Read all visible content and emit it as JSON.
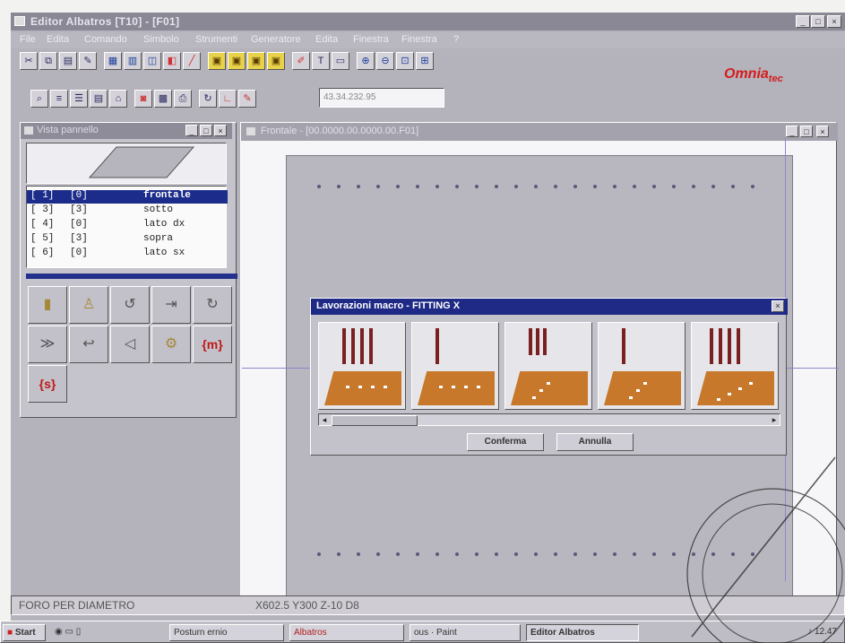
{
  "window": {
    "title": "Editor Albatros [T10] - [F01]",
    "controls": [
      "_",
      "□",
      "×"
    ]
  },
  "menubar": [
    "File",
    "Edita",
    "Comando",
    "Simbolo",
    "Strumenti",
    "Generatore",
    "Edita",
    "Finestra",
    "Finestra",
    "?"
  ],
  "brand": {
    "main": "Omnia",
    "sub": "tec"
  },
  "toolbar2": {
    "coord_value": "43.34.232.95"
  },
  "left_panel": {
    "title": "Vista pannello",
    "faces": [
      {
        "idx": "[ 1]",
        "code": "[0]",
        "name": "frontale"
      },
      {
        "idx": "[ 3]",
        "code": "[3]",
        "name": "sotto"
      },
      {
        "idx": "[ 4]",
        "code": "[0]",
        "name": "lato dx"
      },
      {
        "idx": "[ 5]",
        "code": "[3]",
        "name": "sopra"
      },
      {
        "idx": "[ 6]",
        "code": "[0]",
        "name": "lato sx"
      }
    ],
    "tools": [
      "▮",
      "♙",
      "↺",
      "⇥",
      "↻",
      "≫",
      "↩",
      "◁",
      "⚙",
      "{m}",
      "{s}"
    ]
  },
  "drawing_window": {
    "title": "Frontale - [00.0000.00.0000.00.F01]"
  },
  "dialog": {
    "title": "Lavorazioni macro - FITTING X",
    "close": "×",
    "confirm": "Conferma",
    "cancel": "Annulla",
    "scroll_left": "◂",
    "scroll_right": "▸"
  },
  "statusbar": {
    "left": "FORO PER DIAMETRO",
    "coords": "X602.5 Y300 Z-10 D8"
  },
  "taskbar": {
    "start": "Start",
    "items": [
      "Posturn ernio",
      "Albatros",
      "ous · Paint",
      "Editor Albatros"
    ],
    "clock": "12.47"
  },
  "colors": {
    "selection": "#1c2c8a",
    "dialog_title": "#1e2a86",
    "brand": "#d41b1b",
    "board": "#c7782a"
  }
}
